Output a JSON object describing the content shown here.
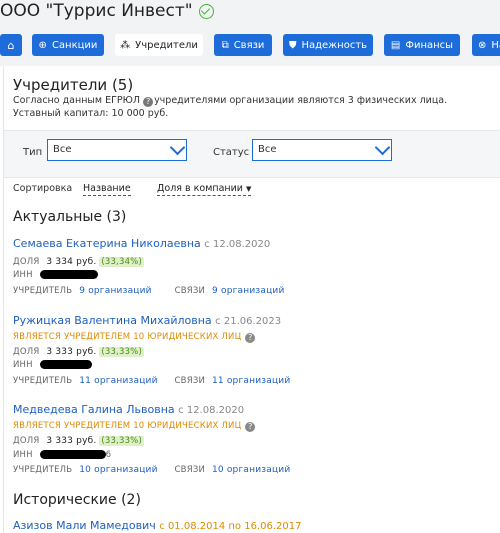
{
  "company": {
    "name": "ООО \"Туррис Инвест\""
  },
  "tabs": [
    {
      "icon": "⌂",
      "label": ""
    },
    {
      "icon": "⊕",
      "label": "Санкции"
    },
    {
      "icon": "⁂",
      "label": "Учредители"
    },
    {
      "icon": "⧉",
      "label": "Связи"
    },
    {
      "icon": "⛊",
      "label": "Надежность"
    },
    {
      "icon": "▤",
      "label": "Финансы"
    },
    {
      "icon": "⊗",
      "label": "На"
    }
  ],
  "founders": {
    "title": "Учредители (5)",
    "egrul_pre": "Согласно данным ЕГРЮЛ",
    "egrul_post": "учредителями организации являются 3 физических лица.",
    "capital": "Уставный капитал: 10 000 руб."
  },
  "filters": {
    "type_label": "Тип",
    "type_value": "Все",
    "status_label": "Статус",
    "status_value": "Все"
  },
  "sort": {
    "label": "Сортировка",
    "by_name": "Название",
    "by_share": "Доля в компании"
  },
  "current": {
    "title": "Актуальные (3)",
    "people": [
      {
        "name": "Семаева Екатерина Николаевна",
        "since": "с 12.08.2020",
        "note": "",
        "share_label": "ДОЛЯ",
        "share_amount": "3 334 руб.",
        "share_pct": "(33,34%)",
        "inn_label": "ИНН",
        "founder_label": "УЧРЕДИТЕЛЬ",
        "founder_link": "9 организаций",
        "links_label": "СВЯЗИ",
        "links_link": "9 организаций"
      },
      {
        "name": "Ружицкая Валентина Михайловна",
        "since": "с 21.06.2023",
        "note": "ЯВЛЯЕТСЯ УЧРЕДИТЕЛЕМ 10 ЮРИДИЧЕСКИХ ЛИЦ",
        "share_label": "ДОЛЯ",
        "share_amount": "3 333 руб.",
        "share_pct": "(33,33%)",
        "inn_label": "ИНН",
        "founder_label": "УЧРЕДИТЕЛЬ",
        "founder_link": "11 организаций",
        "links_label": "СВЯЗИ",
        "links_link": "11 организаций"
      },
      {
        "name": "Медведева Галина Львовна",
        "since": "с 12.08.2020",
        "note": "ЯВЛЯЕТСЯ УЧРЕДИТЕЛЕМ 10 ЮРИДИЧЕСКИХ ЛИЦ",
        "share_label": "ДОЛЯ",
        "share_amount": "3 333 руб.",
        "share_pct": "(33,33%)",
        "inn_label": "ИНН",
        "inn_tail": "6",
        "founder_label": "УЧРЕДИТЕЛЬ",
        "founder_link": "10 организаций",
        "links_label": "СВЯЗИ",
        "links_link": "10 организаций"
      }
    ]
  },
  "historical": {
    "title": "Исторические (2)",
    "people": [
      {
        "name": "Азизов Мали Мамедович",
        "range": "с 01.08.2014 по 16.06.2017"
      }
    ]
  },
  "colors": {
    "accent": "#1d6cd9",
    "link": "#1d5fbf",
    "warning": "#e08a00",
    "verified": "#44b336"
  }
}
